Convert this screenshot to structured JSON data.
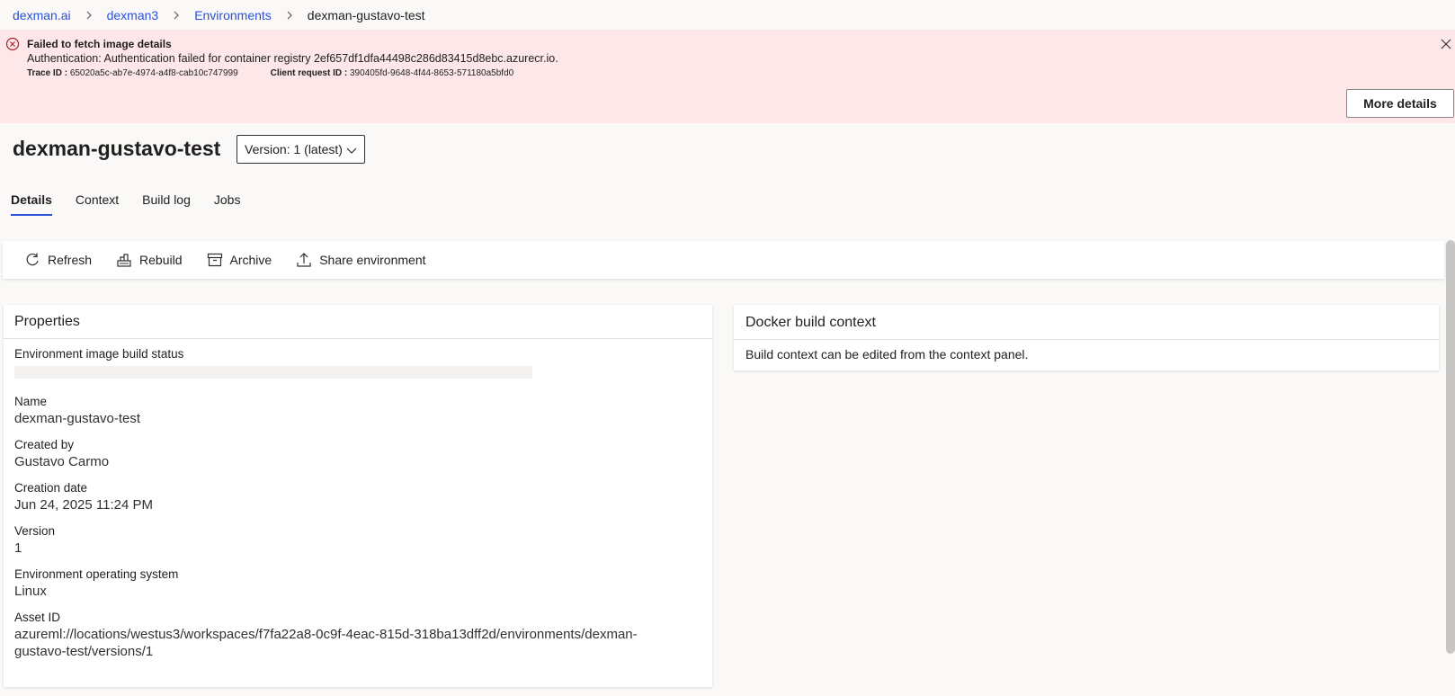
{
  "breadcrumb": {
    "items": [
      "dexman.ai",
      "dexman3",
      "Environments"
    ],
    "current": "dexman-gustavo-test"
  },
  "banner": {
    "title": "Failed to fetch image details",
    "message": "Authentication: Authentication failed for container registry 2ef657df1dfa44498c286d83415d8ebc.azurecr.io.",
    "trace_label": "Trace ID :",
    "trace_value": "65020a5c-ab7e-4974-a4f8-cab10c747999",
    "client_label": "Client request ID :",
    "client_value": "390405fd-9648-4f44-8653-571180a5bfd0",
    "more_details": "More details",
    "bg_color": "#fde7e9"
  },
  "page": {
    "title": "dexman-gustavo-test",
    "version_select": "Version: 1 (latest)"
  },
  "tabs": [
    "Details",
    "Context",
    "Build log",
    "Jobs"
  ],
  "active_tab": "Details",
  "toolbar": {
    "refresh": "Refresh",
    "rebuild": "Rebuild",
    "archive": "Archive",
    "share": "Share environment"
  },
  "properties": {
    "header": "Properties",
    "build_status_label": "Environment image build status",
    "name_label": "Name",
    "name_value": "dexman-gustavo-test",
    "created_by_label": "Created by",
    "created_by_value": "Gustavo Carmo",
    "creation_date_label": "Creation date",
    "creation_date_value": "Jun 24, 2025 11:24 PM",
    "version_label": "Version",
    "version_value": "1",
    "os_label": "Environment operating system",
    "os_value": "Linux",
    "asset_id_label": "Asset ID",
    "asset_id_value_line1": "azureml://locations/westus3/workspaces/f7fa22a8-0c9f-4eac-815d-318ba13dff2d/environments/dexman-",
    "asset_id_value_line2": "gustavo-test/versions/1"
  },
  "docker": {
    "header": "Docker build context",
    "body": "Build context can be edited from the context panel."
  },
  "colors": {
    "accent": "#2b50d6",
    "error_icon": "#a4262c"
  }
}
